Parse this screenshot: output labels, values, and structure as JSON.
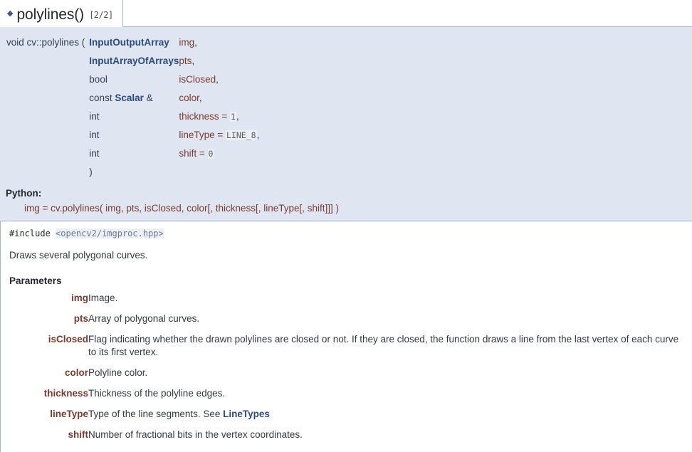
{
  "header": {
    "permalink_icon": "diamond-bullet-icon",
    "title": "polylines()",
    "index": "[2/2]"
  },
  "signature": {
    "return_and_name": "void cv::polylines (",
    "close_paren": ")",
    "params": [
      {
        "type": "InputOutputArray",
        "type_is_link": true,
        "type_prefix": "",
        "type_suffix": "",
        "name": "img",
        "default": "",
        "trail": ","
      },
      {
        "type": "InputArrayOfArrays",
        "type_is_link": true,
        "type_prefix": "",
        "type_suffix": "",
        "name": "pts",
        "default": "",
        "trail": ","
      },
      {
        "type": "bool",
        "type_is_link": false,
        "type_prefix": "",
        "type_suffix": "",
        "name": "isClosed",
        "default": "",
        "trail": ","
      },
      {
        "type": "Scalar",
        "type_is_link": true,
        "type_prefix": "const ",
        "type_suffix": " &",
        "name": "color",
        "default": "",
        "trail": ","
      },
      {
        "type": "int",
        "type_is_link": false,
        "type_prefix": "",
        "type_suffix": "",
        "name": "thickness",
        "default": "1",
        "trail": ","
      },
      {
        "type": "int",
        "type_is_link": false,
        "type_prefix": "",
        "type_suffix": "",
        "name": "lineType",
        "default": "LINE_8",
        "trail": ","
      },
      {
        "type": "int",
        "type_is_link": false,
        "type_prefix": "",
        "type_suffix": "",
        "name": "shift",
        "default": "0",
        "trail": ""
      }
    ]
  },
  "python": {
    "label": "Python:",
    "signature": "img = cv.polylines( img, pts, isClosed, color[, thickness[, lineType[, shift]]] )"
  },
  "body": {
    "include_directive": "#include",
    "include_path": "<opencv2/imgproc.hpp>",
    "brief": "Draws several polygonal curves.",
    "parameters_heading": "Parameters",
    "parameters": [
      {
        "name": "img",
        "desc": "Image.",
        "link": ""
      },
      {
        "name": "pts",
        "desc": "Array of polygonal curves.",
        "link": ""
      },
      {
        "name": "isClosed",
        "desc": "Flag indicating whether the drawn polylines are closed or not. If they are closed, the function draws a line from the last vertex of each curve to its first vertex.",
        "link": ""
      },
      {
        "name": "color",
        "desc": "Polyline color.",
        "link": ""
      },
      {
        "name": "thickness",
        "desc": "Thickness of the polyline edges.",
        "link": ""
      },
      {
        "name": "lineType",
        "desc": "Type of the line segments. See ",
        "link": "LineTypes"
      },
      {
        "name": "shift",
        "desc": "Number of fractional bits in the vertex coordinates.",
        "link": ""
      }
    ]
  },
  "colors": {
    "panel_bg": "#dfe5f1",
    "panel_border": "#a3b4d0",
    "link": "#2a4a82",
    "param_name": "#7a3b2e",
    "text": "#33383d"
  }
}
